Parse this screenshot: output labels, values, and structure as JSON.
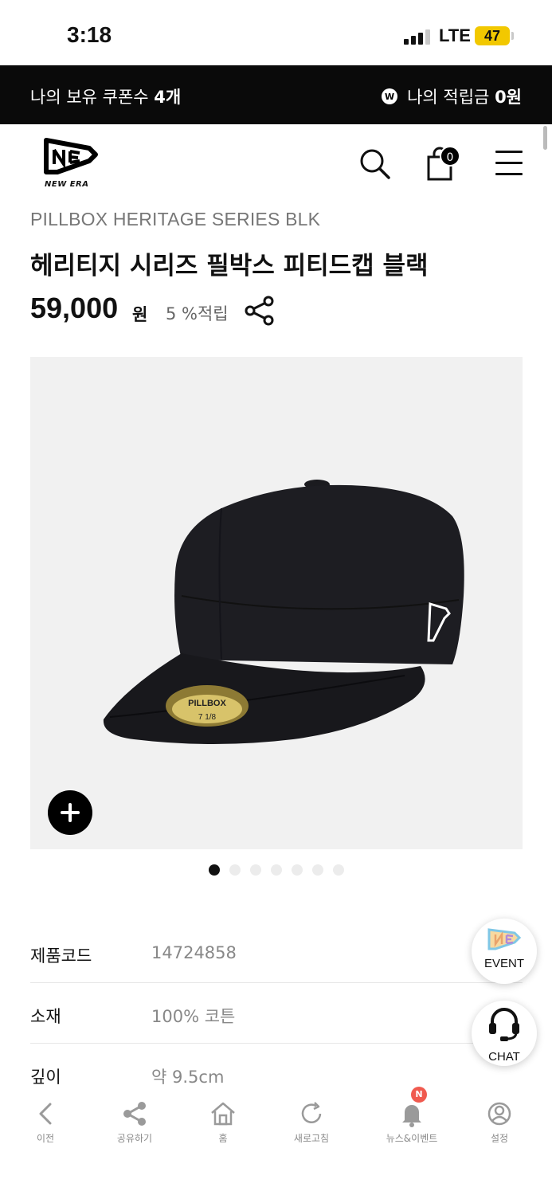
{
  "status_bar": {
    "time": "3:18",
    "network": "LTE",
    "battery": "47"
  },
  "coupon_bar": {
    "coupon_text": "나의 보유 쿠폰수",
    "coupon_count": "4개",
    "points_badge": "W",
    "points_text": "나의 적립금",
    "points_value": "0원"
  },
  "header": {
    "logo_text": "NEW ERA",
    "cart_count": "0",
    "icons": [
      "search-icon",
      "shopping-bag-icon",
      "menu-icon"
    ]
  },
  "product": {
    "name_en": "PILLBOX HERITAGE SERIES BLK",
    "name_ko": "헤리티지 시리즈 필박스 피티드캡 블랙",
    "price": "59,000",
    "price_unit": "원",
    "points_rate": "5 %적립",
    "image_label": "PILLBOX",
    "image_size": "7 1/8"
  },
  "gallery": {
    "total_slides": 7,
    "active_slide": 1
  },
  "specs": [
    {
      "label": "제품코드",
      "value": "14724858"
    },
    {
      "label": "소재",
      "value": "100% 코튼"
    },
    {
      "label": "깊이",
      "value": "약 9.5cm"
    }
  ],
  "floating": {
    "event_label": "EVENT",
    "chat_label": "CHAT"
  },
  "bottom_nav": {
    "items": [
      {
        "label": "이전",
        "icon": "back-icon"
      },
      {
        "label": "공유하기",
        "icon": "share-icon"
      },
      {
        "label": "홈",
        "icon": "home-icon"
      },
      {
        "label": "새로고침",
        "icon": "refresh-icon"
      },
      {
        "label": "뉴스&이벤트",
        "icon": "bell-icon"
      },
      {
        "label": "설정",
        "icon": "settings-icon"
      }
    ],
    "news_badge": "N"
  },
  "colors": {
    "coupon_bar_bg": "#0a0a0a",
    "badge_red": "#f05a4f",
    "battery_yellow": "#f2c800"
  }
}
